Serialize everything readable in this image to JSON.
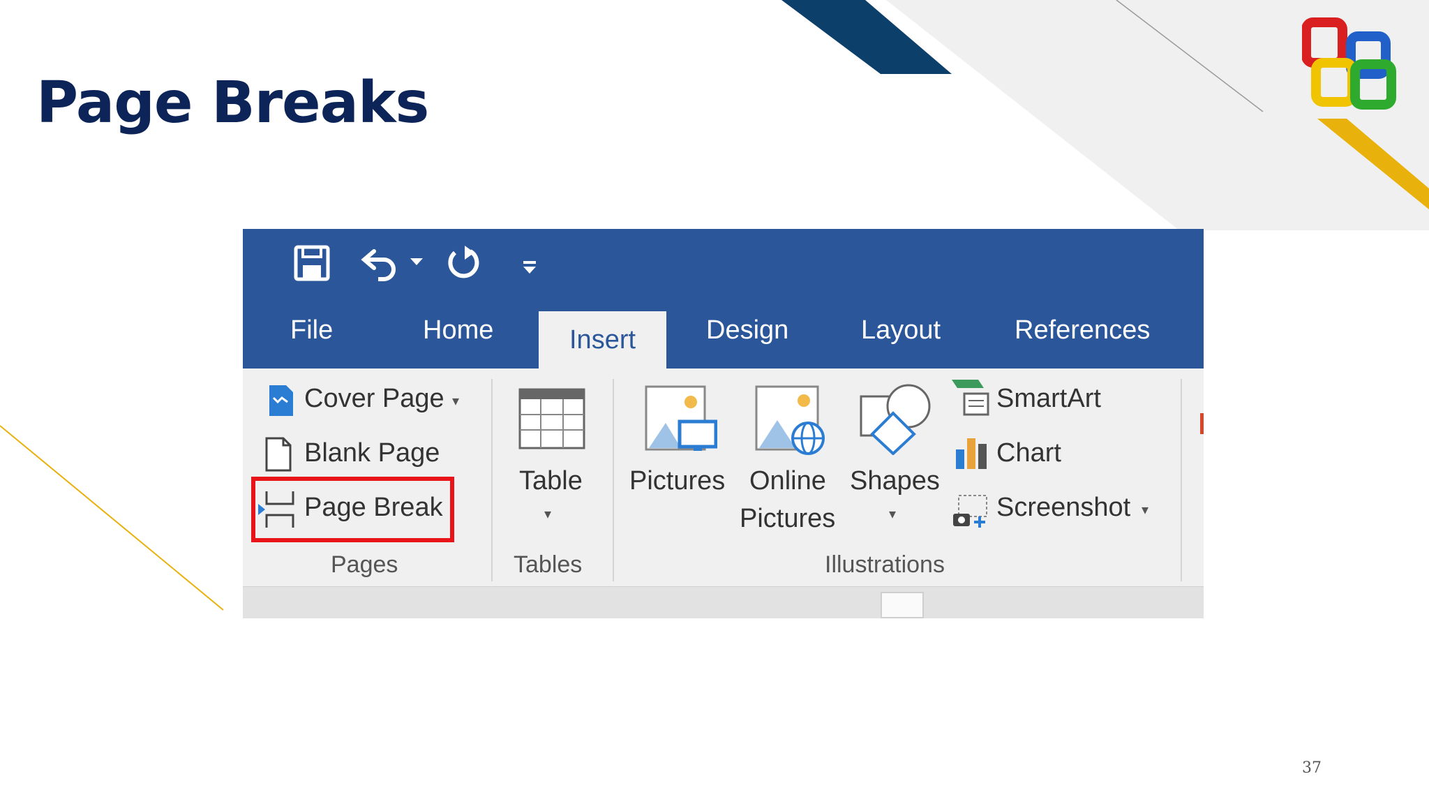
{
  "slide": {
    "title": "Page Breaks",
    "page_number": "37"
  },
  "colors": {
    "title": "#0c2458",
    "ribbon_blue": "#2b579a",
    "highlight_red": "#e8141a",
    "accent_gold": "#e8b10c",
    "accent_navy": "#0d3f6b"
  },
  "qat": {
    "save_icon": "save-icon",
    "undo_icon": "undo-icon",
    "redo_icon": "redo-icon",
    "customize_icon": "customize-qat-icon"
  },
  "tabs": [
    {
      "label": "File"
    },
    {
      "label": "Home"
    },
    {
      "label": "Insert",
      "active": true
    },
    {
      "label": "Design"
    },
    {
      "label": "Layout"
    },
    {
      "label": "References"
    }
  ],
  "groups": {
    "pages": {
      "label": "Pages",
      "items": [
        {
          "label": "Cover Page",
          "icon": "cover-page-icon"
        },
        {
          "label": "Blank Page",
          "icon": "blank-page-icon"
        },
        {
          "label": "Page Break",
          "icon": "page-break-icon",
          "highlighted": true
        }
      ]
    },
    "tables": {
      "label": "Tables",
      "items": [
        {
          "label": "Table",
          "icon": "table-icon"
        }
      ]
    },
    "illustrations": {
      "label": "Illustrations",
      "items": [
        {
          "label": "Pictures",
          "icon": "pictures-icon"
        },
        {
          "label": "Online",
          "label2": "Pictures",
          "icon": "online-pictures-icon"
        },
        {
          "label": "Shapes",
          "icon": "shapes-icon"
        },
        {
          "label": "SmartArt",
          "icon": "smartart-icon"
        },
        {
          "label": "Chart",
          "icon": "chart-icon"
        },
        {
          "label": "Screenshot",
          "icon": "screenshot-icon"
        }
      ]
    }
  }
}
